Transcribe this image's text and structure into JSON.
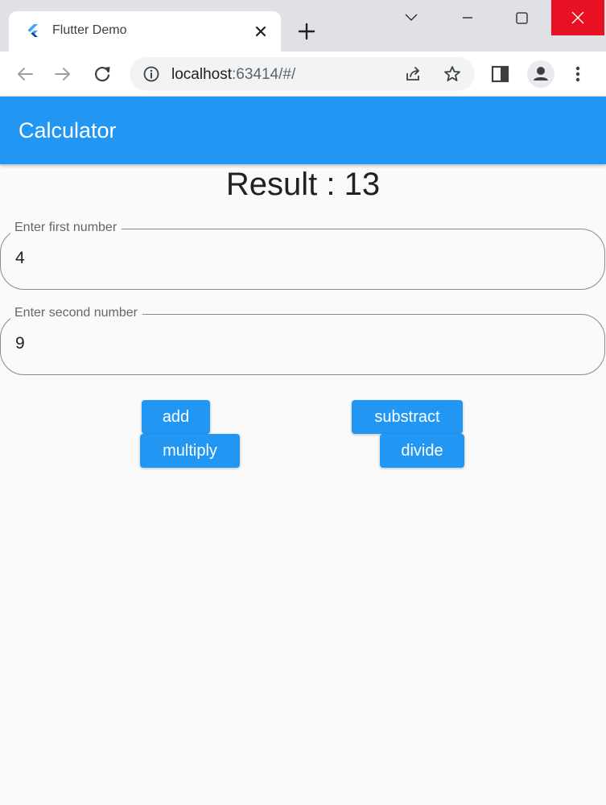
{
  "browser": {
    "tab": {
      "title": "Flutter Demo",
      "favicon": "flutter-logo-icon"
    },
    "address_bar": {
      "host": "localhost",
      "rest": ":63414/#/"
    },
    "icons": [
      "back-arrow-icon",
      "forward-arrow-icon",
      "reload-icon",
      "info-icon",
      "share-icon",
      "star-icon",
      "side-panel-icon",
      "profile-icon",
      "more-vert-icon",
      "chevron-down-icon",
      "minimize-icon",
      "maximize-icon",
      "close-icon",
      "plus-icon"
    ],
    "colors": {
      "tabstrip": "#dfe1e5",
      "close_button": "#e81123"
    }
  },
  "app": {
    "title": "Calculator",
    "result_text": "Result : 13",
    "fields": [
      {
        "label": "Enter first number",
        "value": "4"
      },
      {
        "label": "Enter second number",
        "value": "9"
      }
    ],
    "buttons": {
      "add": "add",
      "subtract": "substract",
      "multiply": "multiply",
      "divide": "divide"
    },
    "colors": {
      "primary": "#2196f3",
      "background": "#fafafa"
    }
  }
}
